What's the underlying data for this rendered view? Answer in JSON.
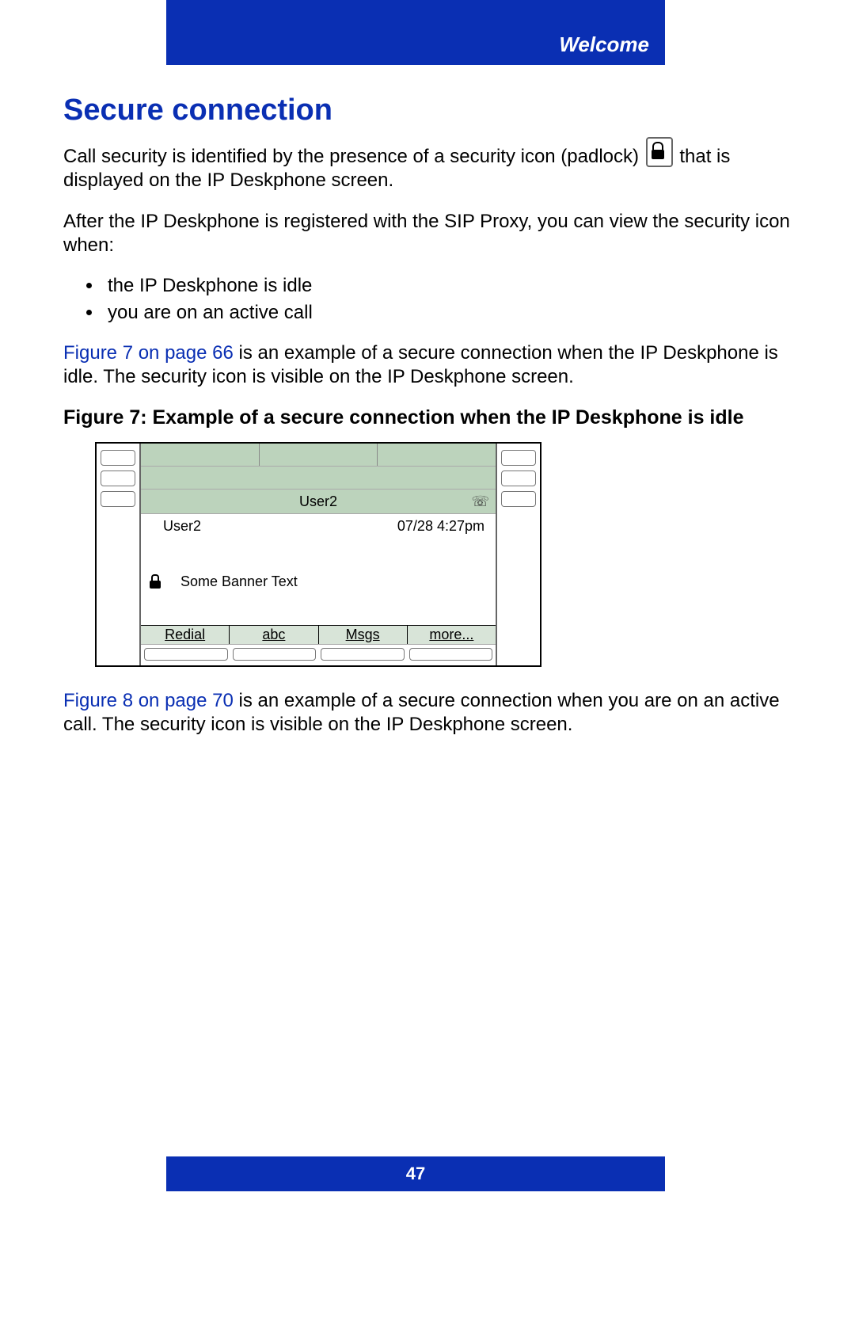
{
  "header": {
    "section": "Welcome"
  },
  "title": "Secure connection",
  "para1_a": "Call security is identified by the presence of a security icon (padlock) ",
  "para1_b": " that is displayed on the IP Deskphone screen.",
  "para2": "After the IP Deskphone is registered with the SIP Proxy, you can view the security icon when:",
  "bullets": [
    "the IP Deskphone is idle",
    "you are on an active call"
  ],
  "xref1": "Figure 7 on page 66",
  "para3_tail": " is an example of a secure connection when the IP Deskphone is idle. The security icon is visible on the IP Deskphone screen.",
  "fig7_caption": "Figure 7: Example of a secure connection when the IP Deskphone is idle",
  "phone": {
    "title_user": "User2",
    "info_user": "User2",
    "info_time": "07/28 4:27pm",
    "banner": "Some Banner Text",
    "softkeys": [
      "Redial",
      "abc",
      "Msgs",
      "more..."
    ]
  },
  "xref2": "Figure 8 on page 70",
  "para4_tail": " is an example of a secure connection when you are on an active call. The security icon is visible on the IP Deskphone screen.",
  "page_number": "47"
}
